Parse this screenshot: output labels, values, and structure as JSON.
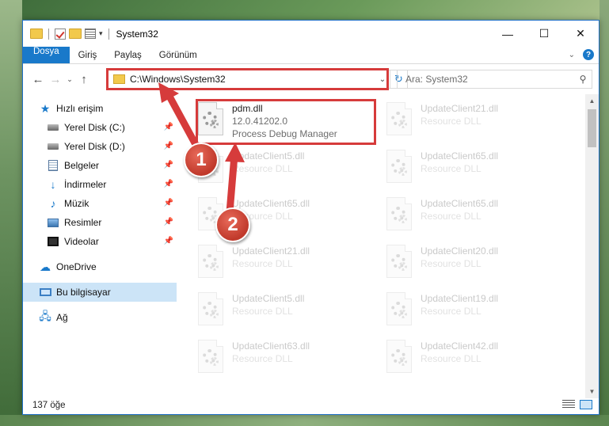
{
  "window": {
    "title": "System32",
    "controls": {
      "minimize": "—",
      "maximize": "☐",
      "close": "✕"
    }
  },
  "ribbon": {
    "tabs": [
      "Dosya",
      "Giriş",
      "Paylaş",
      "Görünüm"
    ],
    "expand": "⌄",
    "help": "?"
  },
  "nav": {
    "back": "←",
    "forward": "→",
    "recent": "⌄",
    "up": "↑",
    "address": "C:\\Windows\\System32",
    "address_dropdown": "⌄",
    "refresh": "↻",
    "search_placeholder": "Ara: System32",
    "search_icon": "⚲"
  },
  "sidebar": {
    "quick_access": "Hızlı erişim",
    "items": [
      {
        "label": "Yerel Disk (C:)",
        "icon": "disk-icon",
        "pinned": true
      },
      {
        "label": "Yerel Disk (D:)",
        "icon": "disk-icon",
        "pinned": true
      },
      {
        "label": "Belgeler",
        "icon": "documents-icon",
        "pinned": true
      },
      {
        "label": "İndirmeler",
        "icon": "downloads-icon",
        "pinned": true
      },
      {
        "label": "Müzik",
        "icon": "music-icon",
        "pinned": true
      },
      {
        "label": "Resimler",
        "icon": "pictures-icon",
        "pinned": true
      },
      {
        "label": "Videolar",
        "icon": "videos-icon",
        "pinned": true
      }
    ],
    "pin_glyph": "📌",
    "onedrive": "OneDrive",
    "this_pc": "Bu bilgisayar",
    "network": "Ağ"
  },
  "files": [
    {
      "name": "pdm.dll",
      "line2": "12.0.41202.0",
      "line3": "Process Debug Manager",
      "highlight": true
    },
    {
      "name": "UpdateClient21.dll",
      "line2": "Resource DLL",
      "line3": ""
    },
    {
      "name": "UpdateClient5.dll",
      "line2": "Resource DLL",
      "line3": ""
    },
    {
      "name": "UpdateClient65.dll",
      "line2": "Resource DLL",
      "line3": ""
    },
    {
      "name": "UpdateClient65.dll",
      "line2": "Resource DLL",
      "line3": ""
    },
    {
      "name": "UpdateClient65.dll",
      "line2": "Resource DLL",
      "line3": ""
    },
    {
      "name": "UpdateClient21.dll",
      "line2": "Resource DLL",
      "line3": ""
    },
    {
      "name": "UpdateClient20.dll",
      "line2": "Resource DLL",
      "line3": ""
    },
    {
      "name": "UpdateClient5.dll",
      "line2": "Resource DLL",
      "line3": ""
    },
    {
      "name": "UpdateClient19.dll",
      "line2": "Resource DLL",
      "line3": ""
    },
    {
      "name": "UpdateClient63.dll",
      "line2": "Resource DLL",
      "line3": ""
    },
    {
      "name": "UpdateClient42.dll",
      "line2": "Resource DLL",
      "line3": ""
    }
  ],
  "status": {
    "count": "137 öğe"
  },
  "callouts": [
    "1",
    "2"
  ],
  "colors": {
    "accent": "#1979ca",
    "callout": "#c0392b",
    "highlight_box": "#d63b3b",
    "selected": "#cce4f7"
  }
}
